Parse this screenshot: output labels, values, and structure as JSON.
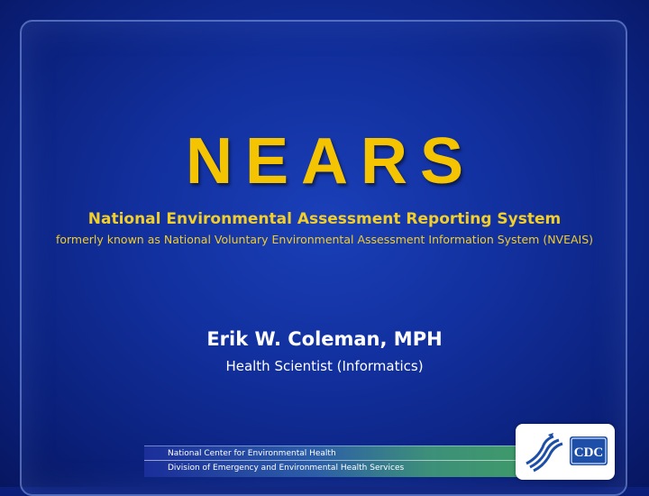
{
  "slide": {
    "title": "NEARS",
    "subtitle": "National Environmental Assessment Reporting System",
    "formerly": "formerly known as National Voluntary Environmental Assessment Information System (NVEAIS)",
    "presenter_name": "Erik W. Coleman, MPH",
    "presenter_role": "Health Scientist (Informatics)"
  },
  "footer": {
    "line1": "National Center for Environmental Health",
    "line2": "Division of Emergency and Environmental Health Services"
  },
  "logos": {
    "hhs_icon": "hhs-eagle-icon",
    "cdc_text": "CDC"
  },
  "colors": {
    "background": "#12309e",
    "title": "#f5c400",
    "subtitle": "#f1ce2a",
    "text": "#ffffff",
    "cdc_blue": "#1d4fa8"
  }
}
